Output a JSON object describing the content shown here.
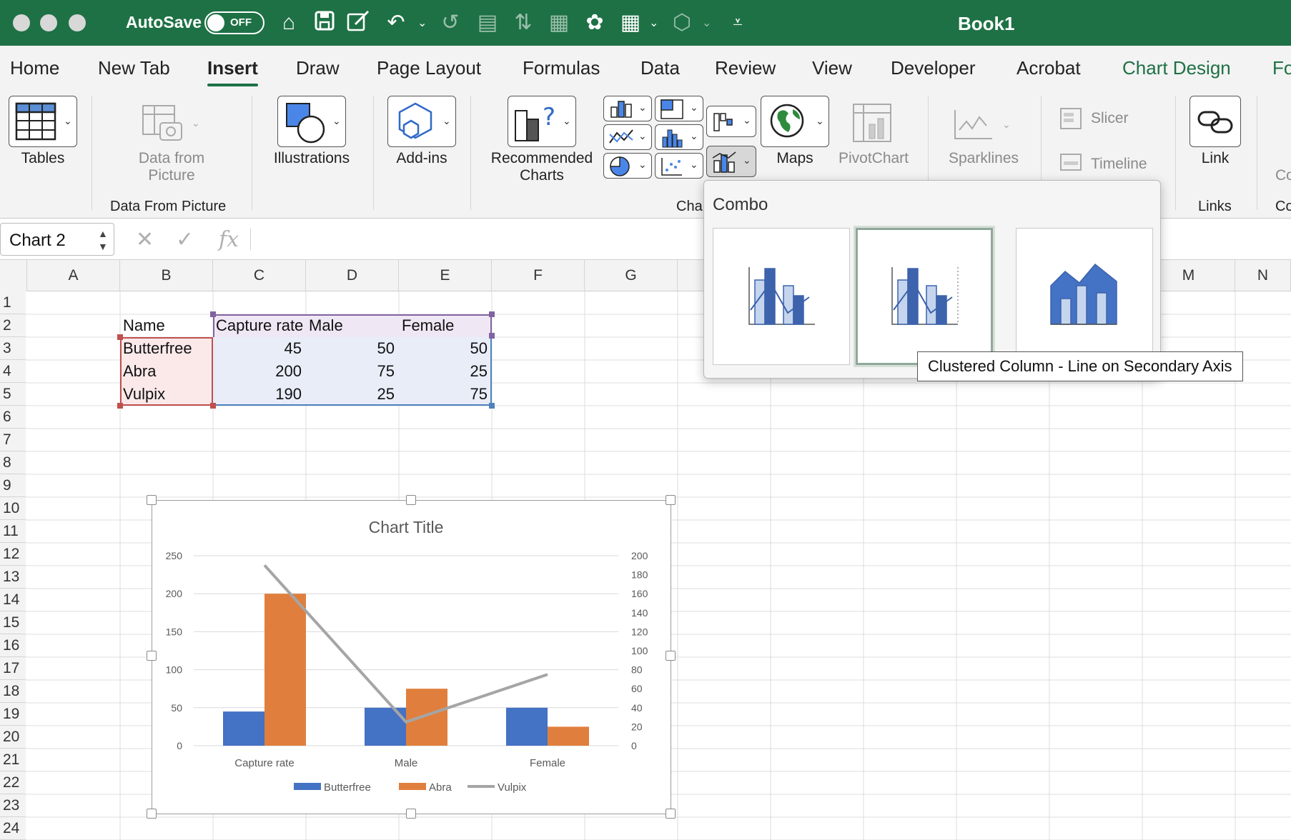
{
  "titlebar": {
    "autosave_label": "AutoSave",
    "autosave_state": "OFF",
    "doc_title": "Book1"
  },
  "tabs": [
    "Home",
    "New Tab",
    "Insert",
    "Draw",
    "Page Layout",
    "Formulas",
    "Data",
    "Review",
    "View",
    "Developer",
    "Acrobat",
    "Chart Design",
    "Fo"
  ],
  "active_tab": "Insert",
  "ribbon": {
    "tables": "Tables",
    "data_from_picture": "Data from Picture",
    "data_from_picture_l1": "Data from",
    "data_from_picture_l2": "Picture",
    "data_from_picture_group": "Data From Picture",
    "illustrations": "Illustrations",
    "addins": "Add-ins",
    "recommended_charts_l1": "Recommended",
    "recommended_charts_l2": "Charts",
    "charts_group_partial": "Cha",
    "maps": "Maps",
    "pivotchart": "PivotChart",
    "sparklines": "Sparklines",
    "slicer": "Slicer",
    "timeline": "Timeline",
    "link": "Link",
    "links_group": "Links",
    "partial_co1": "Co",
    "partial_co2": "Co"
  },
  "formula_bar": {
    "name_box": "Chart 2",
    "fx": "fx"
  },
  "columns": [
    "A",
    "B",
    "C",
    "D",
    "E",
    "F",
    "G",
    "M",
    "N"
  ],
  "rows": [
    "1",
    "2",
    "3",
    "4",
    "5",
    "6",
    "7",
    "8",
    "9",
    "10",
    "11",
    "12",
    "13",
    "14",
    "15",
    "16",
    "17",
    "18",
    "19",
    "20",
    "21",
    "22",
    "23",
    "24"
  ],
  "table": {
    "headers": [
      "Name",
      "Capture rate",
      "Male",
      "Female"
    ],
    "rows": [
      {
        "name": "Butterfree",
        "values": [
          "45",
          "50",
          "50"
        ]
      },
      {
        "name": "Abra",
        "values": [
          "200",
          "75",
          "25"
        ]
      },
      {
        "name": "Vulpix",
        "values": [
          "190",
          "25",
          "75"
        ]
      }
    ]
  },
  "combo": {
    "title": "Combo",
    "tooltip": "Clustered Column - Line on Secondary Axis",
    "options": [
      "clustered-column-line",
      "clustered-column-line-secondary-axis",
      "stacked-area-clustered-column"
    ],
    "selected": 1
  },
  "colors": {
    "excel_green": "#1e7145",
    "series_blue": "#4472c4",
    "series_orange": "#e07f3d",
    "series_gray": "#a5a5a5"
  },
  "chart_data": {
    "type": "bar",
    "title": "Chart Title",
    "categories": [
      "Capture rate",
      "Male",
      "Female"
    ],
    "series": [
      {
        "name": "Butterfree",
        "type": "bar",
        "axis": "primary",
        "color": "#4472c4",
        "values": [
          45,
          50,
          50
        ]
      },
      {
        "name": "Abra",
        "type": "bar",
        "axis": "primary",
        "color": "#e07f3d",
        "values": [
          200,
          75,
          25
        ]
      },
      {
        "name": "Vulpix",
        "type": "line",
        "axis": "secondary",
        "color": "#a5a5a5",
        "values": [
          190,
          25,
          75
        ]
      }
    ],
    "ylim": [
      0,
      250
    ],
    "yticks": [
      "0",
      "50",
      "100",
      "150",
      "200",
      "250"
    ],
    "y2lim": [
      0,
      200
    ],
    "y2ticks": [
      "0",
      "20",
      "40",
      "60",
      "80",
      "100",
      "120",
      "140",
      "160",
      "180",
      "200"
    ],
    "legend": "bottom",
    "grid": true
  }
}
